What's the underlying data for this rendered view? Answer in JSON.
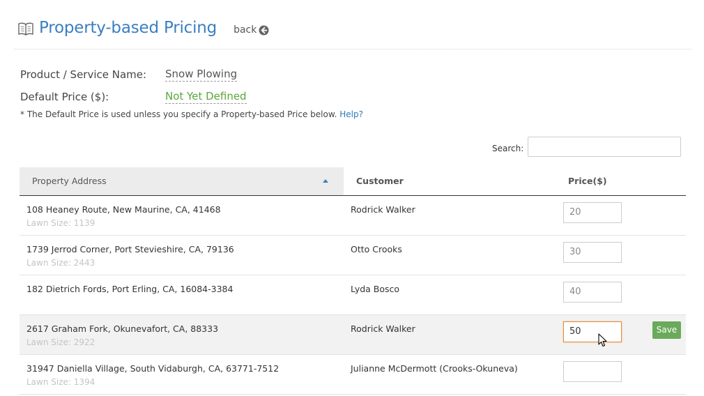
{
  "header": {
    "title": "Property-based Pricing",
    "back_label": "back"
  },
  "info": {
    "name_label": "Product / Service Name:",
    "name_value": "Snow Plowing",
    "price_label": "Default Price ($):",
    "price_value": "Not Yet Defined",
    "note": "* The Default Price is used unless you specify a Property-based Price below.",
    "help_label": "Help?"
  },
  "search": {
    "label": "Search:",
    "value": ""
  },
  "table": {
    "columns": [
      "Property Address",
      "Customer",
      "Price($)"
    ],
    "sort": "ascending",
    "save_label": "Save",
    "rows": [
      {
        "address": "108 Heaney Route, New Maurine, CA, 41468",
        "lawn": "Lawn Size: 1139",
        "customer": "Rodrick Walker",
        "price": "20"
      },
      {
        "address": "1739 Jerrod Corner, Port Stevieshire, CA, 79136",
        "lawn": "Lawn Size: 2443",
        "customer": "Otto Crooks",
        "price": "30"
      },
      {
        "address": "182 Dietrich Fords, Port Erling, CA, 16084-3384",
        "lawn": "",
        "customer": "Lyda Bosco",
        "price": "40"
      },
      {
        "address": "2617 Graham Fork, Okunevafort, CA, 88333",
        "lawn": "Lawn Size: 2922",
        "customer": "Rodrick Walker",
        "price": "50"
      },
      {
        "address": "31947 Daniella Village, South Vidaburgh, CA, 63771-7512",
        "lawn": "Lawn Size: 1394",
        "customer": "Julianne McDermott (Crooks-Okuneva)",
        "price": ""
      }
    ]
  },
  "colors": {
    "title": "#3a7fc0",
    "not_defined": "#5aa63a",
    "save_button": "#6aaa5a",
    "active_border": "#e58a3a"
  },
  "icons": [
    "book-icon",
    "back-arrow-icon",
    "sort-ascending-icon",
    "mouse-cursor-icon"
  ]
}
